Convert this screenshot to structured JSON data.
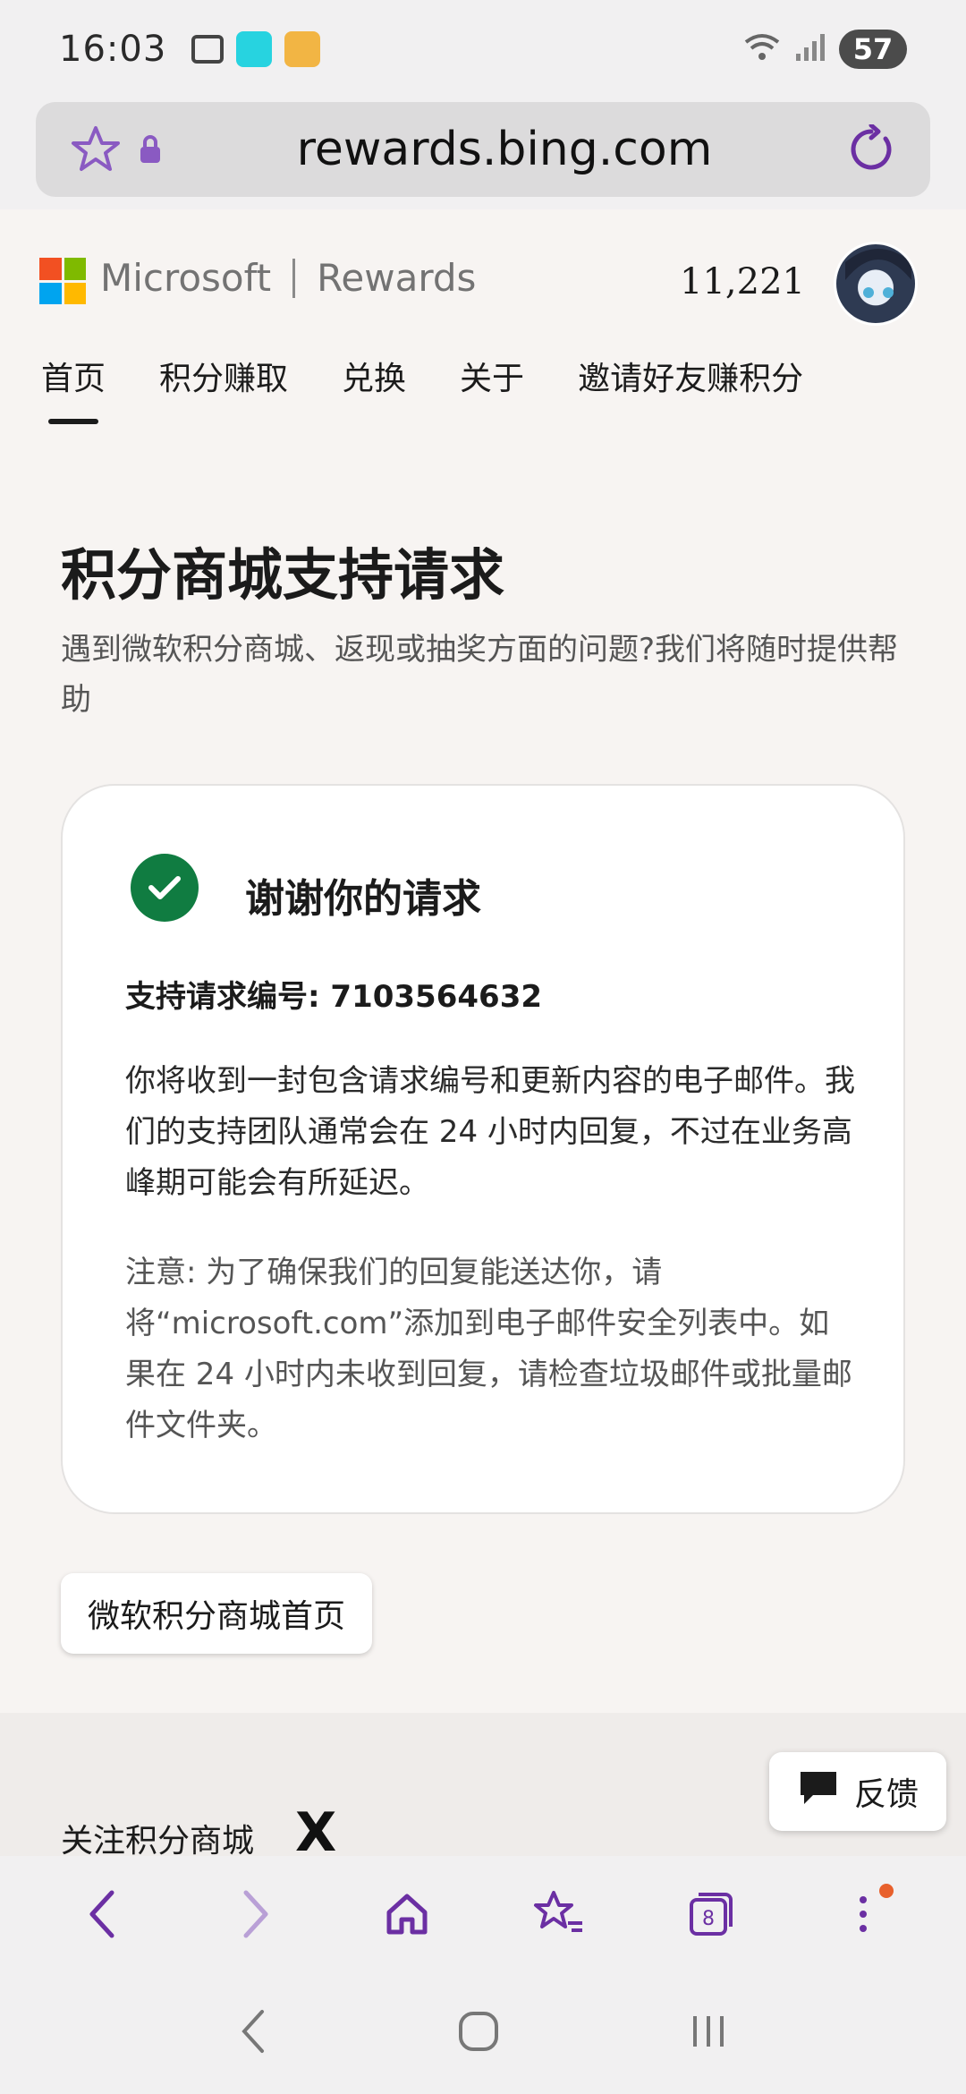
{
  "status_bar": {
    "time": "16:03",
    "battery": "57"
  },
  "browser": {
    "url": "rewards.bing.com",
    "tab_count": "8"
  },
  "header": {
    "brand_left": "Microsoft",
    "brand_right": "Rewards",
    "points": "11,221",
    "nav": [
      "首页",
      "积分赚取",
      "兑换",
      "关于",
      "邀请好友赚积分"
    ]
  },
  "main": {
    "title": "积分商城支持请求",
    "subtitle": "遇到微软积分商城、返现或抽奖方面的问题?我们将随时提供帮助",
    "card": {
      "title": "谢谢你的请求",
      "request_number": "支持请求编号: 7103564632",
      "body": "你将收到一封包含请求编号和更新内容的电子邮件。我们的支持团队通常会在 24 小时内回复，不过在业务高峰期可能会有所延迟。",
      "note": "注意: 为了确保我们的回复能送达你，请将“microsoft.com”添加到电子邮件安全列表中。如果在 24 小时内未收到回复，请检查垃圾邮件或批量邮件文件夹。"
    },
    "home_button": "微软积分商城首页"
  },
  "footer": {
    "follow_label": "关注积分商城",
    "x_logo": "X"
  },
  "feedback": {
    "label": "反馈"
  },
  "colors": {
    "accent_purple": "#6b2fa3",
    "success_green": "#107c41",
    "ms_red": "#f25022",
    "ms_green": "#7fba00",
    "ms_blue": "#00a4ef",
    "ms_yellow": "#ffb900"
  }
}
